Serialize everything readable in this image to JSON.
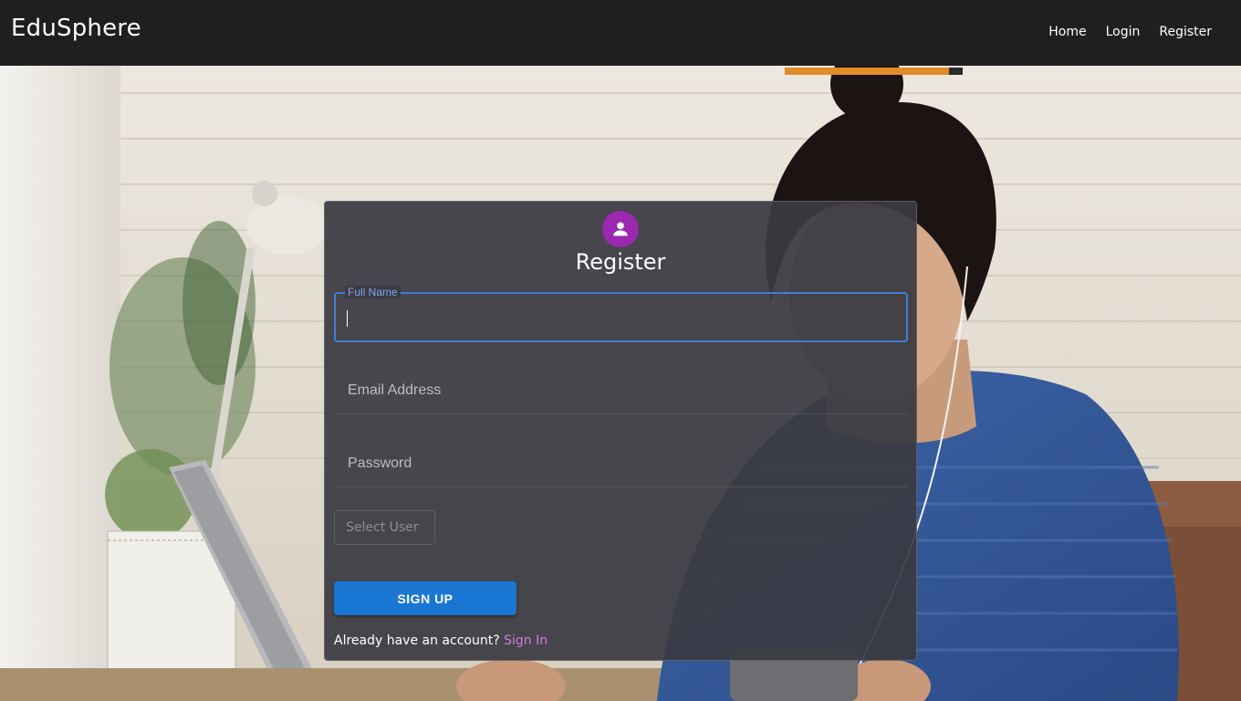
{
  "navbar": {
    "brand": "EduSphere",
    "links": [
      "Home",
      "Login",
      "Register"
    ]
  },
  "background": {
    "description_icon": "person-working-at-laptop-photo"
  },
  "register_card": {
    "avatar_icon": "user-icon",
    "title": "Register",
    "full_name": {
      "label": "Full Name",
      "value": ""
    },
    "email": {
      "placeholder": "Email Address",
      "value": ""
    },
    "password": {
      "placeholder": "Password",
      "value": ""
    },
    "user_select": {
      "selected": "Select User"
    },
    "signup_label": "SIGN UP",
    "signin_prompt": "Already have an account?",
    "signin_link": "Sign In"
  },
  "colors": {
    "navbar_bg": "#1e1f21",
    "card_bg": "#3a3a42",
    "avatar_bg": "#9c27b0",
    "focus_blue": "#3f7fd9",
    "button_blue": "#1976d2",
    "link_purple": "#d17be0"
  }
}
